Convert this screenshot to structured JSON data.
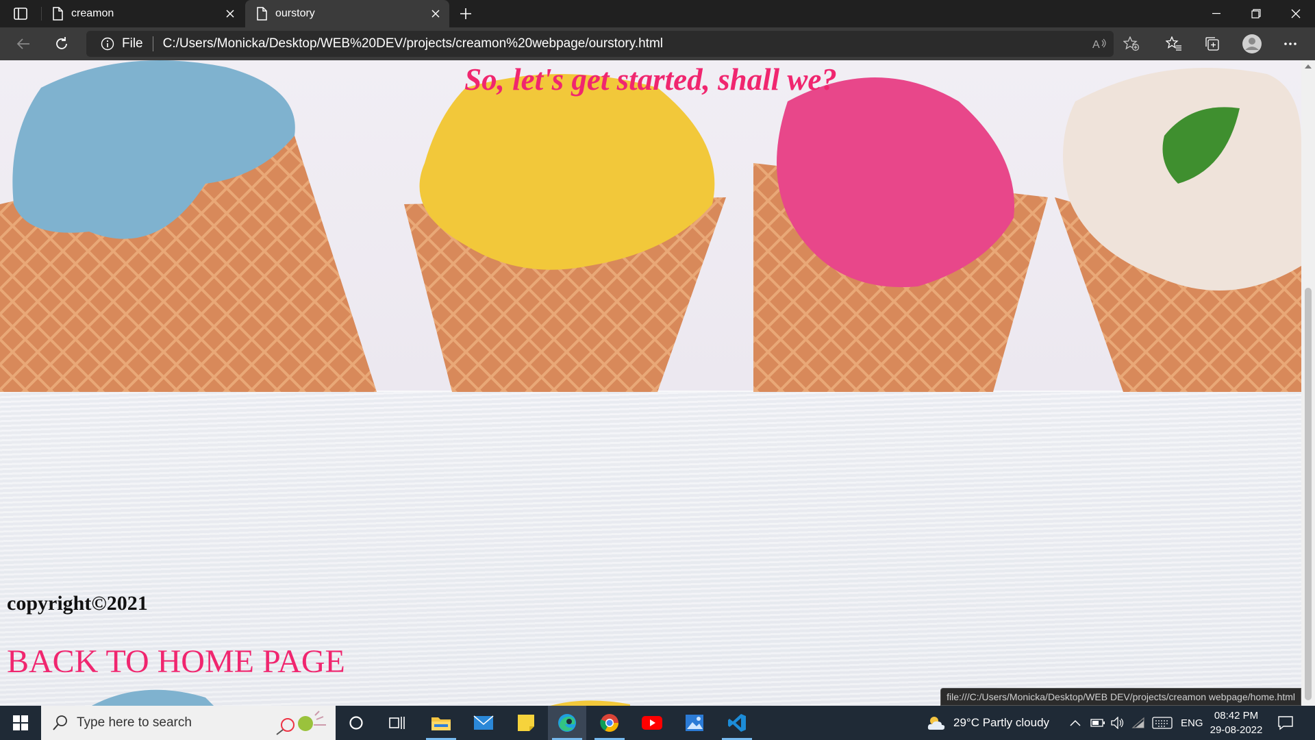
{
  "browser": {
    "tabs": [
      {
        "label": "creamon",
        "active": false
      },
      {
        "label": "ourstory",
        "active": true
      }
    ],
    "address": {
      "scheme_label": "File",
      "url": "C:/Users/Monicka/Desktop/WEB%20DEV/projects/creamon%20webpage/ourstory.html"
    },
    "status_url": "file:///C:/Users/Monicka/Desktop/WEB DEV/projects/creamon webpage/home.html"
  },
  "page": {
    "headline": "So, let's get started, shall we?",
    "copyright": "copyright©2021",
    "back_link": "BACK TO HOME PAGE",
    "colors": {
      "accent": "#f0266f",
      "text": "#111111"
    },
    "image": {
      "subject": "four ice cream scoops in waffle cones",
      "scoop_colors": [
        "#7fb2cf",
        "#f2c83a",
        "#e8478a",
        "#efe3da"
      ]
    }
  },
  "taskbar": {
    "search_placeholder": "Type here to search",
    "weather": "29°C  Partly cloudy",
    "language": "ENG",
    "time": "08:42 PM",
    "date": "29-08-2022",
    "apps": [
      "cortana-icon",
      "task-view-icon",
      "file-explorer-icon",
      "mail-icon",
      "sticky-notes-icon",
      "edge-icon",
      "chrome-icon",
      "youtube-icon",
      "photos-icon",
      "vscode-icon"
    ]
  }
}
